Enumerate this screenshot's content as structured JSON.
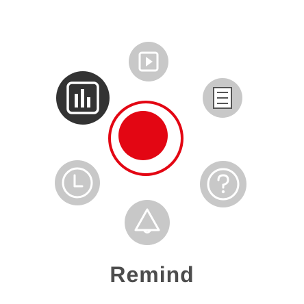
{
  "menu": {
    "items": [
      {
        "id": "play",
        "icon": "play-icon"
      },
      {
        "id": "list",
        "icon": "list-icon"
      },
      {
        "id": "help",
        "icon": "help-icon"
      },
      {
        "id": "remind",
        "icon": "bell-icon"
      },
      {
        "id": "clock",
        "icon": "clock-icon"
      },
      {
        "id": "stats",
        "icon": "bar-chart-icon"
      }
    ],
    "center": {
      "icon": "record-icon"
    },
    "caption": "Remind",
    "colors": {
      "accent": "#e30613",
      "icon_gray": "#c8c8c8",
      "active": "#333333"
    }
  }
}
